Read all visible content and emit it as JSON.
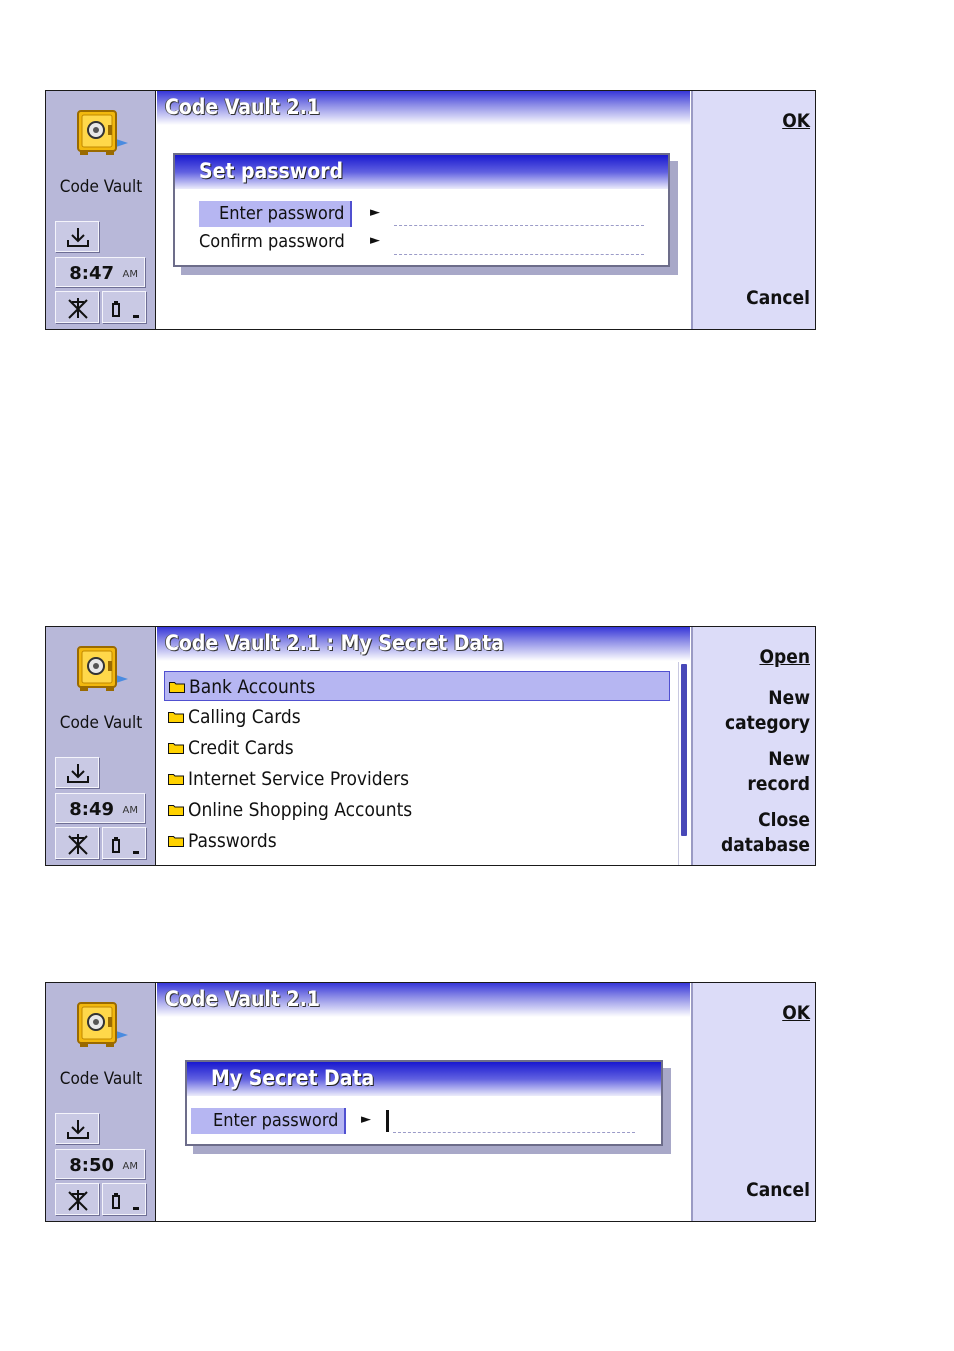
{
  "app": {
    "name": "Code Vault"
  },
  "screens": [
    {
      "time": "8:47",
      "ampm": "AM",
      "title": "Code Vault 2.1",
      "dialog": {
        "title": "Set password",
        "fields": [
          {
            "label": "Enter password",
            "value": ""
          },
          {
            "label": "Confirm password",
            "value": ""
          }
        ]
      },
      "buttons": [
        "OK",
        "Cancel"
      ]
    },
    {
      "time": "8:49",
      "ampm": "AM",
      "title": "Code Vault 2.1 : My Secret Data",
      "folders": [
        "Bank Accounts",
        "Calling Cards",
        "Credit Cards",
        "Internet Service Providers",
        "Online Shopping Accounts",
        "Passwords"
      ],
      "selected_index": 0,
      "buttons": [
        {
          "line1": "Open",
          "line2": ""
        },
        {
          "line1": "New",
          "line2": "category"
        },
        {
          "line1": "New",
          "line2": "record"
        },
        {
          "line1": "Close",
          "line2": "database"
        }
      ]
    },
    {
      "time": "8:50",
      "ampm": "AM",
      "title": "Code Vault 2.1",
      "dialog": {
        "title": "My Secret Data",
        "fields": [
          {
            "label": "Enter password",
            "value": ""
          }
        ]
      },
      "buttons": [
        "OK",
        "Cancel"
      ]
    }
  ],
  "icons": {
    "app": "safe-icon",
    "download": "download-icon",
    "signal": "no-signal-icon",
    "battery": "battery-icon"
  },
  "colors": {
    "title_gradient": "#3636d8",
    "left_panel": "#b8b8d9",
    "right_panel": "#dcdcf8",
    "selection": "#b6b6f2"
  }
}
